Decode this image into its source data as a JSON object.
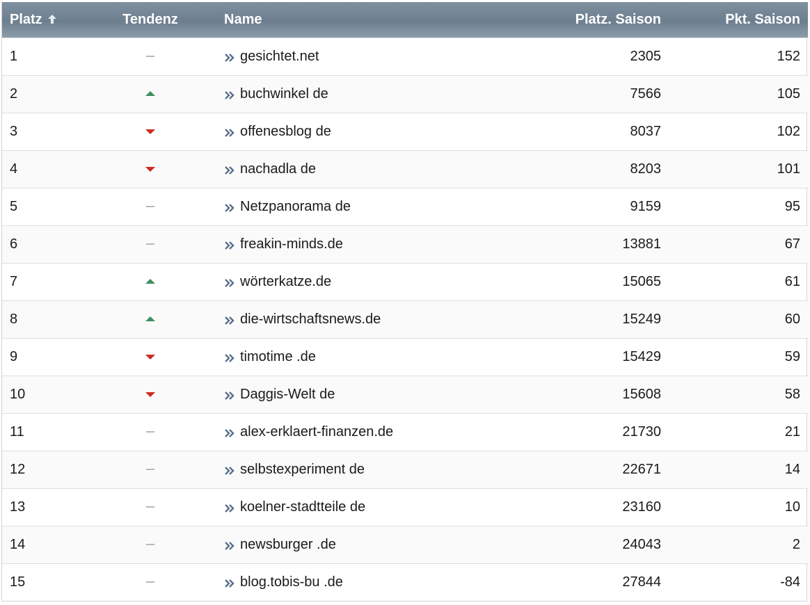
{
  "table": {
    "headers": {
      "platz": "Platz",
      "tendenz": "Tendenz",
      "name": "Name",
      "platz_saison": "Platz. Saison",
      "pkt_saison": "Pkt. Saison"
    },
    "sort_icon": "sort-ascending-arrow-icon",
    "colors": {
      "header_bg": "#7a8b9b",
      "trend_up": "#3f8f5f",
      "trend_down": "#cc2a22",
      "trend_neutral": "#b8b8b8",
      "link_icon": "#5a6f8a"
    },
    "rows": [
      {
        "rank": "1",
        "trend": "neutral",
        "name": "gesichtet.net",
        "season_rank": "2305",
        "season_points": "152"
      },
      {
        "rank": "2",
        "trend": "up",
        "name": "buchwinkel de",
        "season_rank": "7566",
        "season_points": "105"
      },
      {
        "rank": "3",
        "trend": "down",
        "name": "offenesblog de",
        "season_rank": "8037",
        "season_points": "102"
      },
      {
        "rank": "4",
        "trend": "down",
        "name": "nachadla de",
        "season_rank": "8203",
        "season_points": "101"
      },
      {
        "rank": "5",
        "trend": "neutral",
        "name": "Netzpanorama de",
        "season_rank": "9159",
        "season_points": "95"
      },
      {
        "rank": "6",
        "trend": "neutral",
        "name": "freakin-minds.de",
        "season_rank": "13881",
        "season_points": "67"
      },
      {
        "rank": "7",
        "trend": "up",
        "name": "wörterkatze.de",
        "season_rank": "15065",
        "season_points": "61"
      },
      {
        "rank": "8",
        "trend": "up",
        "name": "die-wirtschaftsnews.de",
        "season_rank": "15249",
        "season_points": "60"
      },
      {
        "rank": "9",
        "trend": "down",
        "name": "timotime .de",
        "season_rank": "15429",
        "season_points": "59"
      },
      {
        "rank": "10",
        "trend": "down",
        "name": "Daggis-Welt de",
        "season_rank": "15608",
        "season_points": "58"
      },
      {
        "rank": "11",
        "trend": "neutral",
        "name": "alex-erklaert-finanzen.de",
        "season_rank": "21730",
        "season_points": "21"
      },
      {
        "rank": "12",
        "trend": "neutral",
        "name": "selbstexperiment de",
        "season_rank": "22671",
        "season_points": "14"
      },
      {
        "rank": "13",
        "trend": "neutral",
        "name": "koelner-stadtteile de",
        "season_rank": "23160",
        "season_points": "10"
      },
      {
        "rank": "14",
        "trend": "neutral",
        "name": "newsburger .de",
        "season_rank": "24043",
        "season_points": "2"
      },
      {
        "rank": "15",
        "trend": "neutral",
        "name": "blog.tobis-bu .de",
        "season_rank": "27844",
        "season_points": "-84"
      }
    ]
  }
}
